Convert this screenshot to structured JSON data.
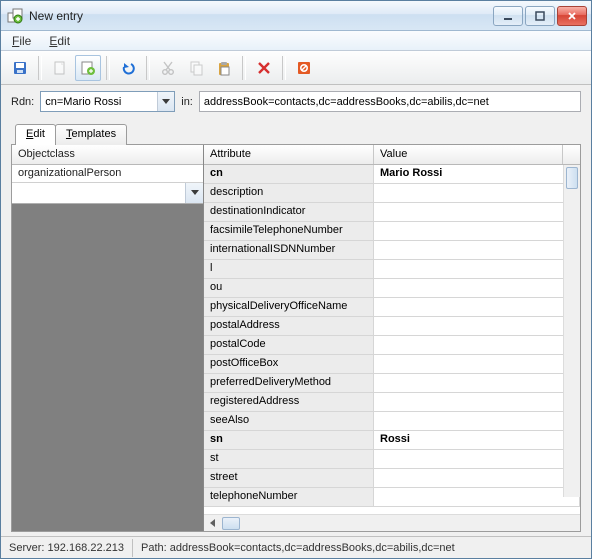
{
  "window": {
    "title": "New entry"
  },
  "menu": {
    "file": "File",
    "edit": "Edit"
  },
  "rdn": {
    "label": "Rdn:",
    "value": "cn=Mario Rossi",
    "in_label": "in:",
    "in_value": "addressBook=contacts,dc=addressBooks,dc=abilis,dc=net"
  },
  "tabs": {
    "edit": "Edit",
    "templates": "Templates"
  },
  "left": {
    "header": "Objectclass",
    "rows": [
      "organizationalPerson"
    ]
  },
  "grid": {
    "headers": {
      "attribute": "Attribute",
      "value": "Value"
    },
    "rows": [
      {
        "attr": "cn",
        "val": "Mario Rossi",
        "bold": true
      },
      {
        "attr": "description",
        "val": ""
      },
      {
        "attr": "destinationIndicator",
        "val": ""
      },
      {
        "attr": "facsimileTelephoneNumber",
        "val": ""
      },
      {
        "attr": "internationalISDNNumber",
        "val": ""
      },
      {
        "attr": "l",
        "val": ""
      },
      {
        "attr": "ou",
        "val": ""
      },
      {
        "attr": "physicalDeliveryOfficeName",
        "val": ""
      },
      {
        "attr": "postalAddress",
        "val": ""
      },
      {
        "attr": "postalCode",
        "val": ""
      },
      {
        "attr": "postOfficeBox",
        "val": ""
      },
      {
        "attr": "preferredDeliveryMethod",
        "val": ""
      },
      {
        "attr": "registeredAddress",
        "val": ""
      },
      {
        "attr": "seeAlso",
        "val": ""
      },
      {
        "attr": "sn",
        "val": "Rossi",
        "bold": true
      },
      {
        "attr": "st",
        "val": ""
      },
      {
        "attr": "street",
        "val": ""
      },
      {
        "attr": "telephoneNumber",
        "val": ""
      }
    ]
  },
  "status": {
    "server_label": "Server:",
    "server": "192.168.22.213",
    "path_label": "Path:",
    "path": "addressBook=contacts,dc=addressBooks,dc=abilis,dc=net"
  }
}
